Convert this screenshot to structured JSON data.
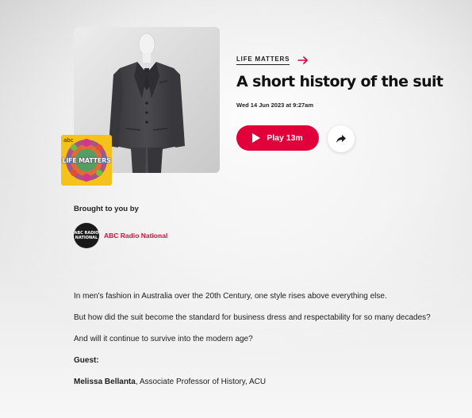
{
  "program": {
    "eyebrow": "LIFE MATTERS",
    "logo_text": "LIFE MATTERS",
    "logo_mark": "abc"
  },
  "episode": {
    "title": "A short history of the suit",
    "date": "Wed 14 Jun 2023 at 9:27am",
    "play_label": "Play 13m"
  },
  "sponsor": {
    "label": "Brought to you by",
    "station_name": "ABC Radio National",
    "avatar_text": "ABC RADIO NATIONAL"
  },
  "description": {
    "p1": "In men's fashion in Australia over the 20th Century, one style rises above everything else.",
    "p2": "But how did the suit become the standard for business dress and respectability for so many decades?",
    "p3": "And will it continue to survive into the modern age?",
    "guest_label": "Guest:",
    "guest_name": "Melissa Bellanta",
    "guest_role": ", Associate Professor of History, ACU"
  },
  "icons": {
    "arrow": "arrow-right-icon",
    "play": "play-icon",
    "share": "share-icon"
  },
  "colors": {
    "accent": "#e2003b",
    "link": "#d1123f",
    "logo_bg": "#f4c21a"
  }
}
